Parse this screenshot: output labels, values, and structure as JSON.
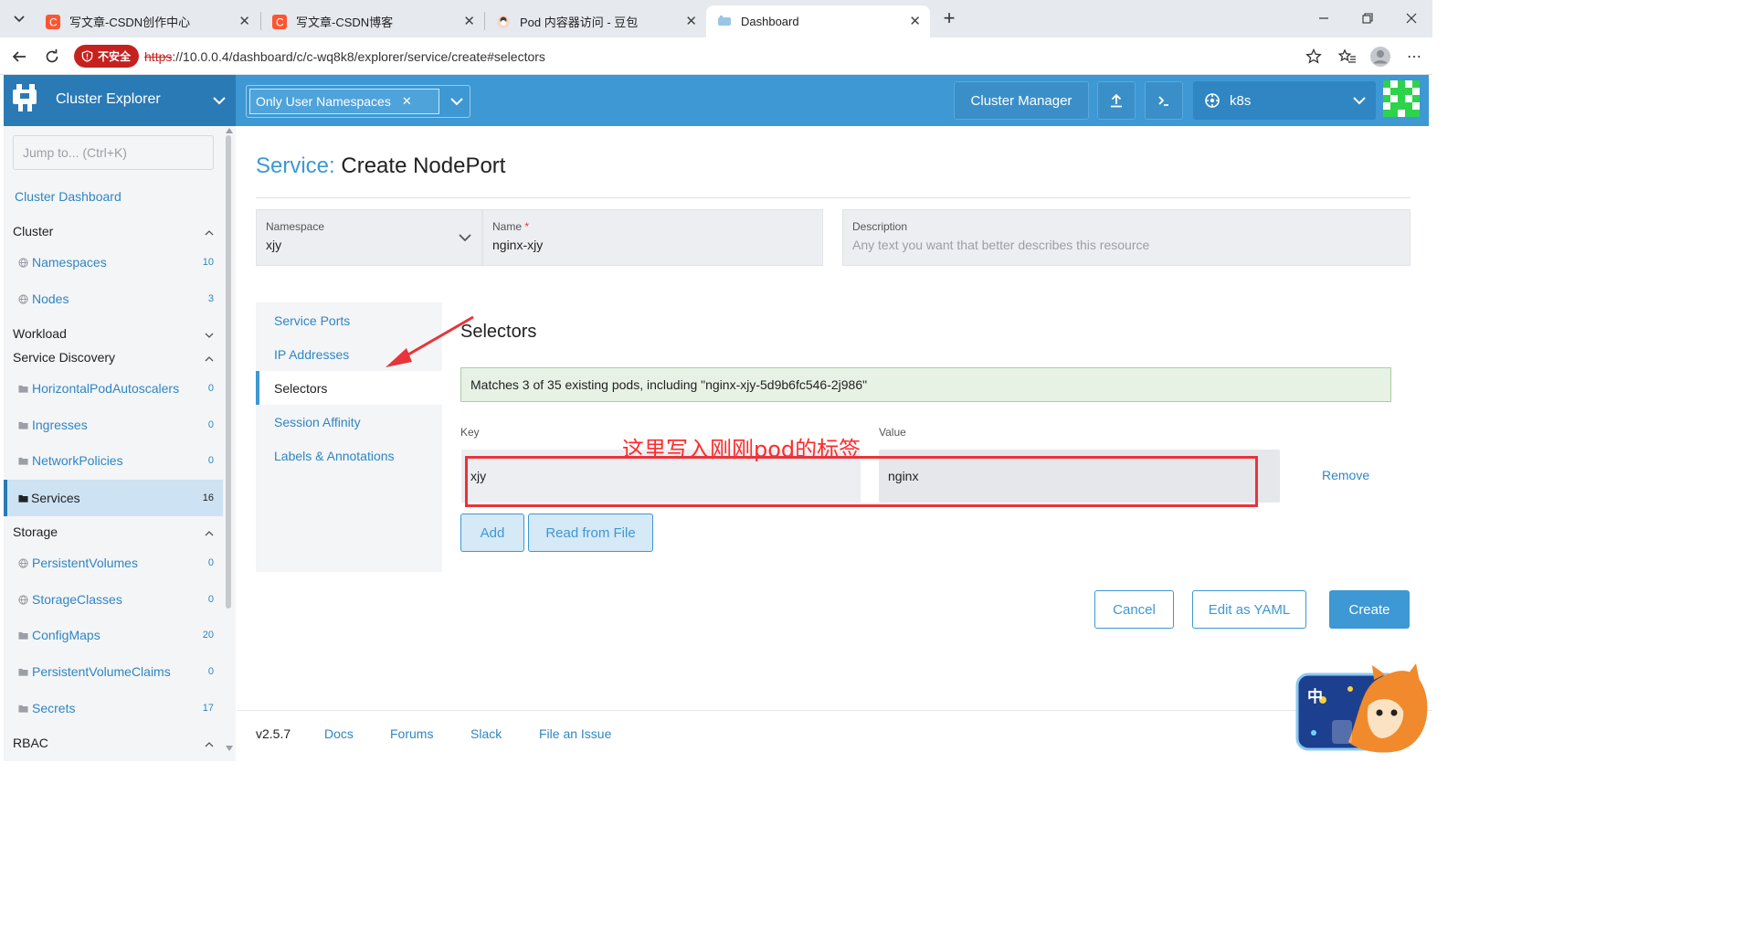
{
  "browser": {
    "tabs": [
      {
        "title": "写文章-CSDN创作中心",
        "icon": "csdn-icon",
        "active": false
      },
      {
        "title": "写文章-CSDN博客",
        "icon": "csdn-icon",
        "active": false
      },
      {
        "title": "Pod 内容器访问 - 豆包",
        "icon": "doubao-icon",
        "active": false
      },
      {
        "title": "Dashboard",
        "icon": "rancher-icon",
        "active": true
      }
    ],
    "security_label": "不安全",
    "url_protocol": "https",
    "url_rest": "://10.0.0.4/dashboard/c/c-wq8k8/explorer/service/create#selectors"
  },
  "header": {
    "app_title": "Cluster Explorer",
    "namespace_filter": "Only User Namespaces",
    "cluster_manager": "Cluster Manager",
    "cluster_name": "k8s"
  },
  "sidebar": {
    "jump_placeholder": "Jump to... (Ctrl+K)",
    "dashboard_link": "Cluster Dashboard",
    "groups": {
      "cluster": "Cluster",
      "workload": "Workload",
      "service_discovery": "Service Discovery",
      "storage": "Storage",
      "rbac": "RBAC"
    },
    "cluster_items": [
      {
        "label": "Namespaces",
        "count": "10",
        "icon": "globe-icon"
      },
      {
        "label": "Nodes",
        "count": "3",
        "icon": "globe-icon"
      }
    ],
    "sd_items": [
      {
        "label": "HorizontalPodAutoscalers",
        "count": "0",
        "icon": "folder-icon"
      },
      {
        "label": "Ingresses",
        "count": "0",
        "icon": "folder-icon"
      },
      {
        "label": "NetworkPolicies",
        "count": "0",
        "icon": "folder-icon"
      },
      {
        "label": "Services",
        "count": "16",
        "icon": "folder-icon",
        "active": true
      }
    ],
    "storage_items": [
      {
        "label": "PersistentVolumes",
        "count": "0",
        "icon": "globe-icon"
      },
      {
        "label": "StorageClasses",
        "count": "0",
        "icon": "globe-icon"
      },
      {
        "label": "ConfigMaps",
        "count": "20",
        "icon": "folder-icon"
      },
      {
        "label": "PersistentVolumeClaims",
        "count": "0",
        "icon": "folder-icon"
      },
      {
        "label": "Secrets",
        "count": "17",
        "icon": "folder-icon"
      }
    ]
  },
  "page": {
    "title_kind": "Service:",
    "title_action": "Create NodePort",
    "namespace_label": "Namespace",
    "namespace_value": "xjy",
    "name_label": "Name",
    "name_required": "*",
    "name_value": "nginx-xjy",
    "description_label": "Description",
    "description_placeholder": "Any text you want that better describes this resource"
  },
  "tabs": [
    "Service Ports",
    "IP Addresses",
    "Selectors",
    "Session Affinity",
    "Labels & Annotations"
  ],
  "selectors": {
    "title": "Selectors",
    "matches": "Matches 3 of 35 existing pods, including \"nginx-xjy-5d9b6fc546-2j986\"",
    "key_label": "Key",
    "value_label": "Value",
    "key_value": "xjy",
    "value_value": "nginx",
    "remove": "Remove",
    "add": "Add",
    "read_from_file": "Read from File"
  },
  "annotation": "这里写入刚刚pod的标签",
  "actions": {
    "cancel": "Cancel",
    "edit_yaml": "Edit as YAML",
    "create": "Create"
  },
  "footer": {
    "version": "v2.5.7",
    "links": [
      "Docs",
      "Forums",
      "Slack",
      "File an Issue"
    ]
  },
  "ime": {
    "label": "中"
  },
  "colors": {
    "brand": "#3d98d3",
    "brand_dark": "#2a7ab6",
    "annotation_red": "#e8343a",
    "match_bg": "#e7f2e5"
  }
}
